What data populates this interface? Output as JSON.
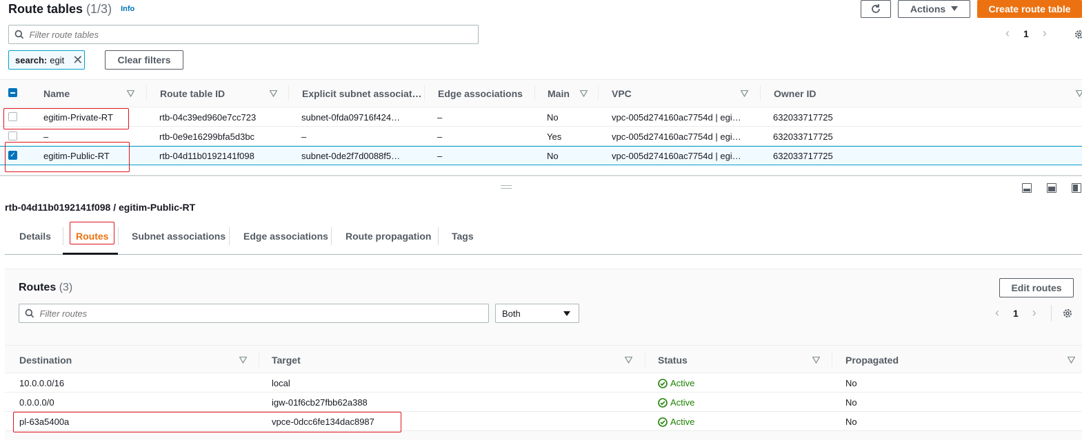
{
  "header": {
    "title": "Route tables",
    "count": "(1/3)",
    "info": "Info",
    "actions_label": "Actions",
    "create_label": "Create route table",
    "search_placeholder": "Filter route tables",
    "page": "1",
    "filter_token_key": "search:",
    "filter_token_value": "egit",
    "clear_filters_label": "Clear filters"
  },
  "table": {
    "columns": [
      "Name",
      "Route table ID",
      "Explicit subnet associat…",
      "Edge associations",
      "Main",
      "VPC",
      "Owner ID"
    ],
    "rows": [
      {
        "name": "egitim-Private-RT",
        "id": "rtb-04c39ed960e7cc723",
        "subnet": "subnet-0fda09716f424…",
        "edge": "–",
        "main": "No",
        "vpc": "vpc-005d274160ac7754d | egi…",
        "owner": "632033717725",
        "checked": false
      },
      {
        "name": "–",
        "id": "rtb-0e9e16299bfa5d3bc",
        "subnet": "–",
        "edge": "–",
        "main": "Yes",
        "vpc": "vpc-005d274160ac7754d | egi…",
        "owner": "632033717725",
        "checked": false
      },
      {
        "name": "egitim-Public-RT",
        "id": "rtb-04d11b0192141f098",
        "subnet": "subnet-0de2f7d0088f5…",
        "edge": "–",
        "main": "No",
        "vpc": "vpc-005d274160ac7754d | egi…",
        "owner": "632033717725",
        "checked": true
      }
    ]
  },
  "detail": {
    "title": "rtb-04d11b0192141f098 / egitim-Public-RT",
    "tabs": [
      "Details",
      "Routes",
      "Subnet associations",
      "Edge associations",
      "Route propagation",
      "Tags"
    ],
    "active_tab": "Routes"
  },
  "routes": {
    "title": "Routes",
    "count": "(3)",
    "edit_label": "Edit routes",
    "search_placeholder": "Filter routes",
    "select_value": "Both",
    "page": "1",
    "columns": [
      "Destination",
      "Target",
      "Status",
      "Propagated"
    ],
    "rows": [
      {
        "destination": "10.0.0.0/16",
        "target": "local",
        "status": "Active",
        "propagated": "No"
      },
      {
        "destination": "0.0.0.0/0",
        "target": "igw-01f6cb27fbb62a388",
        "status": "Active",
        "propagated": "No"
      },
      {
        "destination": "pl-63a5400a",
        "target": "vpce-0dcc6fe134dac8987",
        "status": "Active",
        "propagated": "No"
      }
    ]
  },
  "colors": {
    "link": "#0073bb",
    "primary": "#ec7211",
    "success": "#1d8102",
    "annotation": "#e0111c"
  }
}
